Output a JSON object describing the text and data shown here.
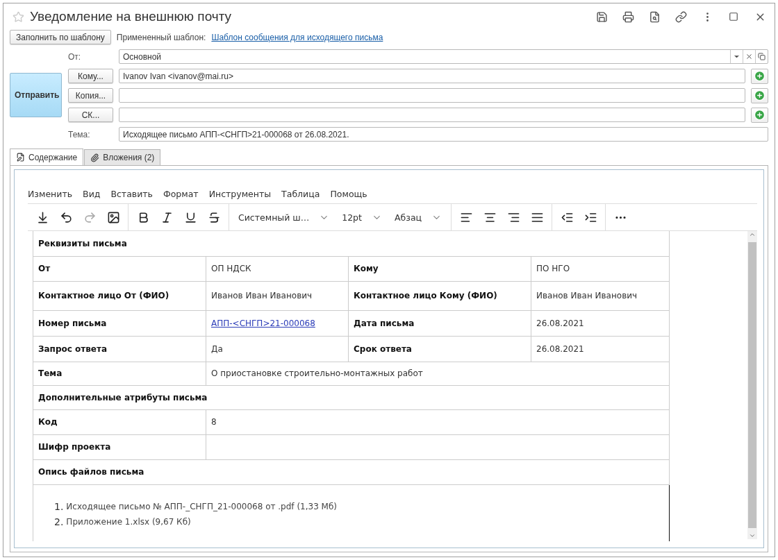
{
  "window": {
    "title": "Уведомление на внешнюю почту",
    "favorite": false
  },
  "template": {
    "button": "Заполнить по шаблону",
    "label": "Примененный шаблон:",
    "link": "Шаблон сообщения для исходящего письма"
  },
  "send_button": "Отправить",
  "from": {
    "label": "От:",
    "value": "Основной"
  },
  "recipients": [
    {
      "button": "Кому...",
      "value": "Ivanov Ivan <ivanov@mai.ru>"
    },
    {
      "button": "Копия..."
    },
    {
      "button": "СК..."
    }
  ],
  "subject": {
    "label": "Тема:",
    "value": "Исходящее письмо АПП-<СНГП>21-000068 от 26.08.2021."
  },
  "tabs": [
    {
      "label": "Содержание",
      "kind": "content",
      "selected": true
    },
    {
      "label": "Вложения (2)",
      "kind": "attachments",
      "selected": false
    }
  ],
  "editor": {
    "menu": [
      "Изменить",
      "Вид",
      "Вставить",
      "Формат",
      "Инструменты",
      "Таблица",
      "Помощь"
    ],
    "toolbar": [
      [
        {
          "kind": "insert",
          "disabled": false
        },
        {
          "kind": "undo",
          "disabled": false
        },
        {
          "kind": "redo",
          "disabled": true
        },
        {
          "kind": "image",
          "disabled": false
        }
      ],
      [
        {
          "kind": "bold",
          "disabled": false
        },
        {
          "kind": "italic",
          "disabled": false
        },
        {
          "kind": "underline",
          "disabled": false
        },
        {
          "kind": "strike",
          "disabled": false
        }
      ],
      [
        {
          "kind": "select",
          "value": "Системный ш…"
        },
        {
          "kind": "select",
          "value": "12pt"
        },
        {
          "kind": "select",
          "value": "Абзац"
        }
      ],
      [
        {
          "kind": "align-left",
          "disabled": false
        },
        {
          "kind": "align-center",
          "disabled": false
        },
        {
          "kind": "align-right",
          "disabled": false
        },
        {
          "kind": "justify",
          "disabled": false
        }
      ],
      [
        {
          "kind": "outdent",
          "disabled": false
        },
        {
          "kind": "indent",
          "disabled": false
        }
      ],
      [
        {
          "kind": "more",
          "disabled": false
        }
      ]
    ],
    "table": [
      {
        "kind": "section",
        "label": "Реквизиты письма"
      },
      {
        "kind": "pair",
        "cells": [
          {
            "label": "От",
            "value": "ОП НДСК"
          },
          {
            "label": "Кому",
            "value": "ПО НГО"
          }
        ]
      },
      {
        "kind": "pair",
        "cells": [
          {
            "label": "Контактное лицо От (ФИО)",
            "value": "Иванов Иван Иванович"
          },
          {
            "label": "Контактное лицо Кому (ФИО)",
            "value": "Иванов Иван Иванович"
          }
        ]
      },
      {
        "kind": "pair",
        "cells": [
          {
            "label": "Номер письма",
            "value": "АПП-<СНГП>21-000068",
            "link": true
          },
          {
            "label": "Дата письма",
            "value": "26.08.2021"
          }
        ]
      },
      {
        "kind": "pair",
        "cells": [
          {
            "label": "Запрос ответа",
            "value": "Да"
          },
          {
            "label": "Срок ответа",
            "value": "26.08.2021"
          }
        ]
      },
      {
        "kind": "wide",
        "label": "Тема",
        "value": "О приостановке строительно-монтажных работ"
      },
      {
        "kind": "section",
        "label": "Дополнительные атрибуты письма"
      },
      {
        "kind": "wide",
        "label": "Код",
        "value": "8"
      },
      {
        "kind": "wide",
        "label": "Шифр проекта"
      },
      {
        "kind": "section",
        "label": "Опись файлов письма"
      },
      {
        "kind": "list",
        "items": [
          {
            "number": "1.",
            "text": "Исходящее письмо № АПП-_СНГП_21-000068 от .pdf (1,33 Мб)"
          },
          {
            "number": "2.",
            "text": "Приложение 1.xlsx (9,67 Кб)"
          }
        ]
      }
    ]
  }
}
